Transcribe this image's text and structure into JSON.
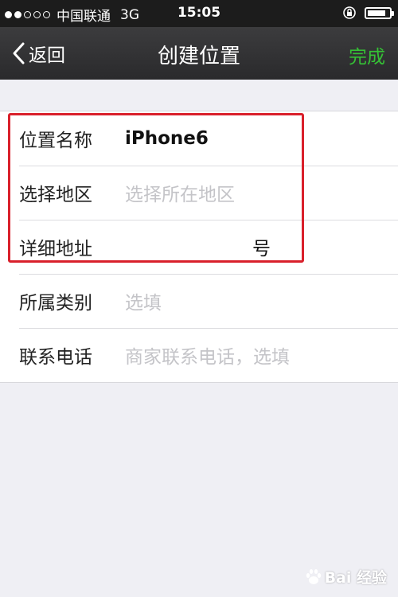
{
  "status_bar": {
    "carrier": "中国联通",
    "network": "3G",
    "time": "15:05",
    "signal_strength": 2,
    "signal_max": 5,
    "battery_level": 0.85
  },
  "nav": {
    "back_label": "返回",
    "title": "创建位置",
    "done_label": "完成",
    "done_color": "#35c135"
  },
  "form": {
    "rows": [
      {
        "label": "位置名称",
        "value": "iPhone6"
      },
      {
        "label": "选择地区",
        "placeholder": "选择所在地区"
      },
      {
        "label": "详细地址",
        "value": "号"
      },
      {
        "label": "所属类别",
        "placeholder": "选填"
      },
      {
        "label": "联系电话",
        "placeholder": "商家联系电话，选填"
      }
    ]
  },
  "highlight_color": "#d9202b",
  "watermark": {
    "text": "Bai 经验",
    "icon": "paw-icon"
  }
}
